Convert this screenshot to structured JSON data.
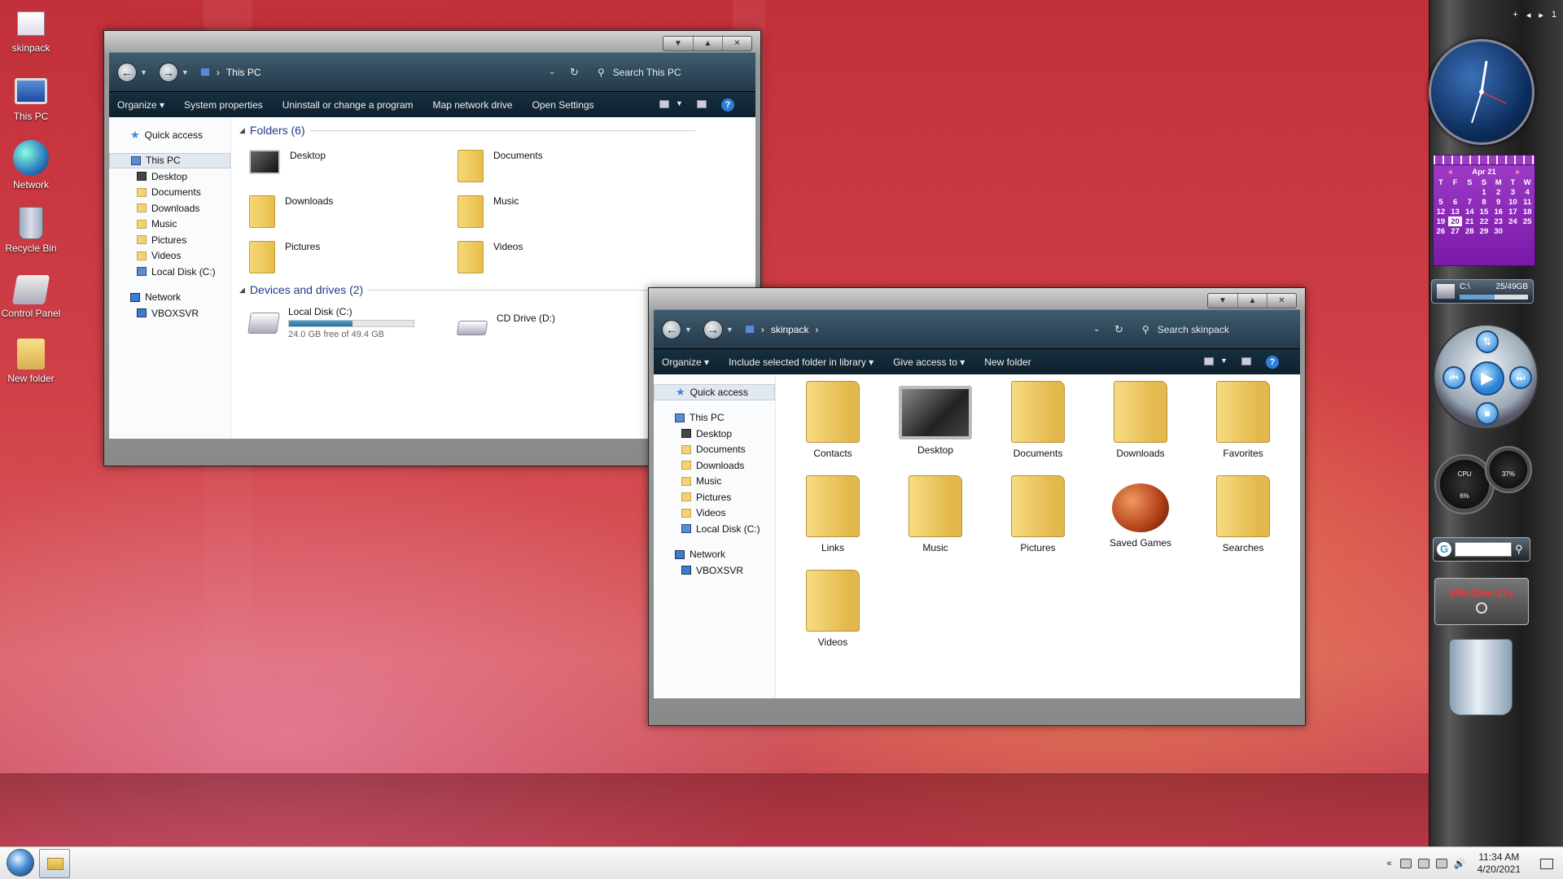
{
  "desktop_icons": [
    {
      "label": "skinpack",
      "icon": "document-icon"
    },
    {
      "label": "This PC",
      "icon": "computer-icon"
    },
    {
      "label": "Network",
      "icon": "network-icon"
    },
    {
      "label": "Recycle Bin",
      "icon": "recycle-bin-icon"
    },
    {
      "label": "Control Panel",
      "icon": "control-panel-icon"
    },
    {
      "label": "New folder",
      "icon": "folder-icon"
    }
  ],
  "window1": {
    "address": "This PC",
    "search_placeholder": "Search This PC",
    "commands": [
      "Organize",
      "System properties",
      "Uninstall or change a program",
      "Map network drive",
      "Open Settings"
    ],
    "nav": [
      "Quick access",
      "This PC",
      "Desktop",
      "Documents",
      "Downloads",
      "Music",
      "Pictures",
      "Videos",
      "Local Disk (C:)",
      "Network",
      "VBOXSVR"
    ],
    "folders_header": "Folders (6)",
    "folders": [
      "Desktop",
      "Documents",
      "Downloads",
      "Music",
      "Pictures",
      "Videos"
    ],
    "drives_header": "Devices and drives (2)",
    "drives": [
      {
        "name": "Local Disk (C:)",
        "free": "24.0 GB free of 49.4 GB",
        "used_fraction": 0.51
      },
      {
        "name": "CD Drive (D:)"
      }
    ]
  },
  "window2": {
    "address": "skinpack",
    "search_placeholder": "Search skinpack",
    "commands": [
      "Organize",
      "Include selected folder in library",
      "Give access to",
      "New folder"
    ],
    "nav": [
      "Quick access",
      "This PC",
      "Desktop",
      "Documents",
      "Downloads",
      "Music",
      "Pictures",
      "Videos",
      "Local Disk (C:)",
      "Network",
      "VBOXSVR"
    ],
    "items": [
      "Contacts",
      "Desktop",
      "Documents",
      "Downloads",
      "Favorites",
      "Links",
      "Music",
      "Pictures",
      "Saved Games",
      "Searches",
      "Videos"
    ]
  },
  "gadgets": {
    "top_controls": [
      "+",
      "◂",
      "▸",
      "1"
    ],
    "calendar": {
      "month": "Apr 21",
      "weekdays": [
        "T",
        "F",
        "S",
        "S",
        "M",
        "T",
        "W"
      ],
      "rows": [
        [
          "",
          "",
          "",
          "1",
          "2",
          "3",
          "4"
        ],
        [
          "5",
          "6",
          "7",
          "8",
          "9",
          "10",
          "11"
        ],
        [
          "12",
          "13",
          "14",
          "15",
          "16",
          "17",
          "18"
        ],
        [
          "19",
          "20",
          "21",
          "22",
          "23",
          "24",
          "25"
        ],
        [
          "26",
          "27",
          "28",
          "29",
          "30",
          "",
          ""
        ]
      ],
      "today": "20"
    },
    "drive": {
      "label": "C:\\",
      "usage": "25/49GB"
    },
    "cpu": {
      "label": "CPU",
      "value": "6%"
    },
    "mem": {
      "value": "37%"
    },
    "timer": "00h:20m:17s"
  },
  "taskbar": {
    "time": "11:34 AM",
    "date": "4/20/2021"
  }
}
